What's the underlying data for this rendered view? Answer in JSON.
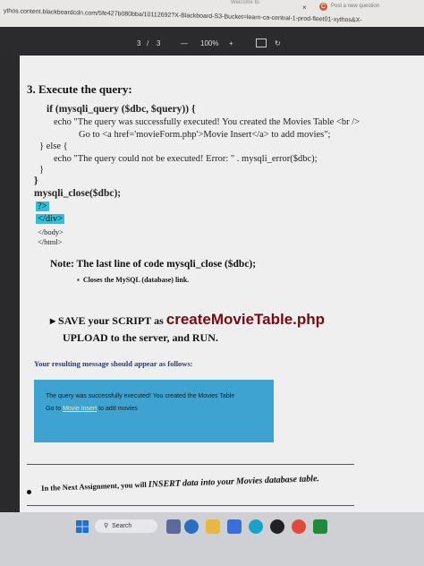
{
  "browser": {
    "url": "ythos.content.blackboardcdn.com/5fe427b080bba/10112692?X-Blackboard-S3-Bucket=learn-ca-central-1-prod-fleet01-xythos&X-",
    "tab_welcome": "Welcome to",
    "tab_close": "×",
    "tab_title": "Post a new question"
  },
  "toolbar": {
    "page_current": "3",
    "page_separator": "/",
    "page_total": "3",
    "zoom_minus": "—",
    "zoom": "100%",
    "zoom_plus": "+",
    "rotate": "↻"
  },
  "doc": {
    "step_title": "3. Execute the query:",
    "code_lines": [
      "if (mysqli_query ($dbc, $query)) {",
      "echo \"The query was successfully executed! You created the Movies Table <br />",
      "Go to <a href='movieForm.php'>Movie Insert</a> to add movies\";",
      "} else {",
      "echo \"The query could not be executed! Error: \" . mysqli_error($dbc);",
      "}",
      "}",
      "mysqli_close($dbc);",
      "?>",
      "</div>",
      "</body>",
      "</html>"
    ],
    "note": "Note: The last line of code  mysqli_close ($dbc);",
    "note_bullet": "Closes the MySQL (database) link.",
    "save_prefix": "SAVE your SCRIPT as",
    "save_filename": "createMovieTable.php",
    "upload": "UPLOAD to the server, and RUN.",
    "result_label": "Your resulting message should appear as follows:",
    "msg_line1": "The query was successfully executed! You created the Movies Table",
    "msg_line2_pre": "Go to",
    "msg_link": "Movie Insert",
    "msg_line2_post": "to add movies",
    "next_prefix": "In the Next Assignment, you will",
    "next_insert": "INSERT",
    "next_suffix": "data into your",
    "next_movies": "Movies database table."
  },
  "taskbar": {
    "search_label": "Search",
    "start_color": "#1d6fd1"
  }
}
